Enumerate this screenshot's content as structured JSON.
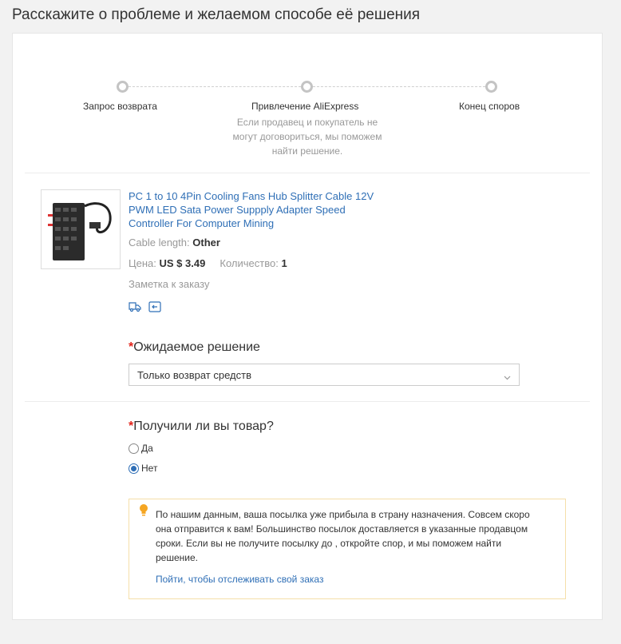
{
  "page": {
    "title": "Расскажите о проблеме и желаемом способе её решения"
  },
  "stepper": {
    "steps": [
      {
        "label": "Запрос возврата",
        "desc": ""
      },
      {
        "label": "Привлечение AliExpress",
        "desc": "Если продавец и покупатель не могут договориться, мы поможем найти решение."
      },
      {
        "label": "Конец споров",
        "desc": ""
      }
    ]
  },
  "product": {
    "title": "PC 1 to 10 4Pin Cooling Fans Hub Splitter Cable 12V PWM LED Sata Power Suppply Adapter Speed Controller For Computer Mining",
    "attr_label": "Cable length:",
    "attr_value": "Other",
    "price_label": "Цена:",
    "price_value": "US $ 3.49",
    "qty_label": "Количество:",
    "qty_value": "1",
    "note": "Заметка к заказу",
    "icons": [
      "truck-icon",
      "return-icon"
    ]
  },
  "resolution": {
    "required_mark": "*",
    "label": "Ожидаемое решение",
    "selected": "Только возврат средств"
  },
  "received": {
    "required_mark": "*",
    "label": "Получили ли вы товар?",
    "options": [
      {
        "label": "Да",
        "checked": false
      },
      {
        "label": "Нет",
        "checked": true
      }
    ]
  },
  "notice": {
    "text": "По нашим данным, ваша посылка уже прибыла в страну назначения. Совсем скоро она отправится к вам! Большинство посылок доставляется в указанные продавцом сроки. Если вы не получите посылку до , откройте спор, и мы поможем найти решение.",
    "link": "Пойти, чтобы отслеживать свой заказ"
  },
  "colors": {
    "accent": "#2f6fb6",
    "required": "#e2231a",
    "notice_border": "#f5dfa9",
    "bulb": "#f5a623"
  }
}
